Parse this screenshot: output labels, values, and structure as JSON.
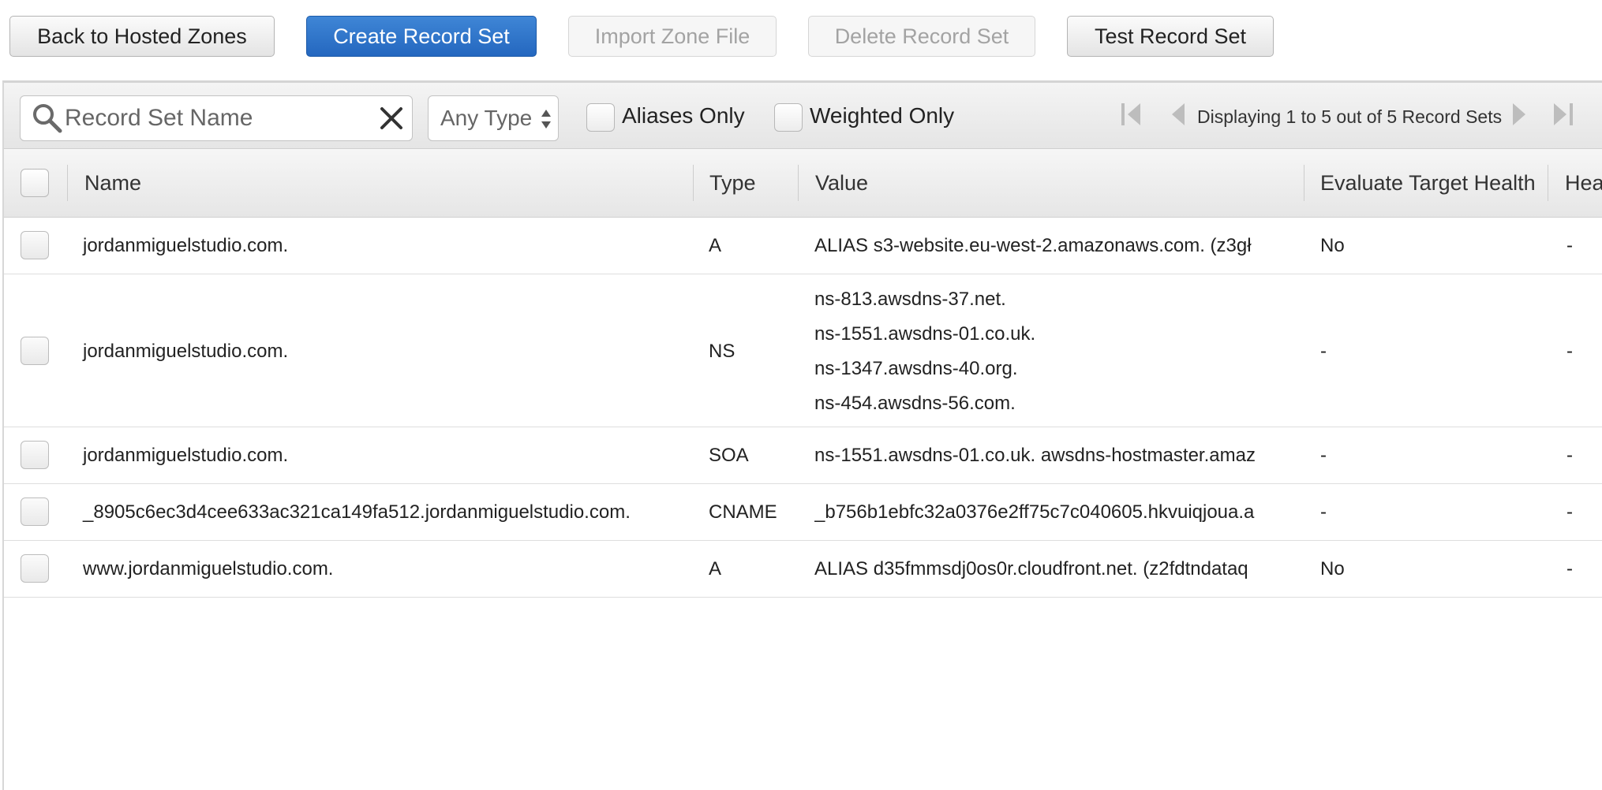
{
  "toolbar": {
    "back_label": "Back to Hosted Zones",
    "create_label": "Create Record Set",
    "import_label": "Import Zone File",
    "delete_label": "Delete Record Set",
    "test_label": "Test Record Set"
  },
  "filter": {
    "search_placeholder": "Record Set Name",
    "type_selected": "Any Type",
    "aliases_label": "Aliases Only",
    "weighted_label": "Weighted Only",
    "pager_text": "Displaying 1 to 5 out of 5 Record Sets"
  },
  "table": {
    "columns": [
      "Name",
      "Type",
      "Value",
      "Evaluate Target Health",
      "Hea"
    ],
    "rows": [
      {
        "name": "jordanmiguelstudio.com.",
        "type": "A",
        "value": "ALIAS s3-website.eu-west-2.amazonaws.com. (z3gł",
        "eval": "No",
        "health": "-"
      },
      {
        "name": "jordanmiguelstudio.com.",
        "type": "NS",
        "values": [
          "ns-813.awsdns-37.net.",
          "ns-1551.awsdns-01.co.uk.",
          "ns-1347.awsdns-40.org.",
          "ns-454.awsdns-56.com."
        ],
        "eval": "-",
        "health": "-"
      },
      {
        "name": "jordanmiguelstudio.com.",
        "type": "SOA",
        "value": "ns-1551.awsdns-01.co.uk. awsdns-hostmaster.amaz",
        "eval": "-",
        "health": "-"
      },
      {
        "name": "_8905c6ec3d4cee633ac321ca149fa512.jordanmiguelstudio.com.",
        "type": "CNAME",
        "value": "_b756b1ebfc32a0376e2ff75c7c040605.hkvuiqjoua.a",
        "eval": "-",
        "health": "-"
      },
      {
        "name": "www.jordanmiguelstudio.com.",
        "type": "A",
        "value": "ALIAS d35fmmsdj0os0r.cloudfront.net. (z2fdtndataq",
        "eval": "No",
        "health": "-"
      }
    ]
  },
  "colors": {
    "primary": "#2a6dc3",
    "disabled_text": "#a3a3a3"
  }
}
